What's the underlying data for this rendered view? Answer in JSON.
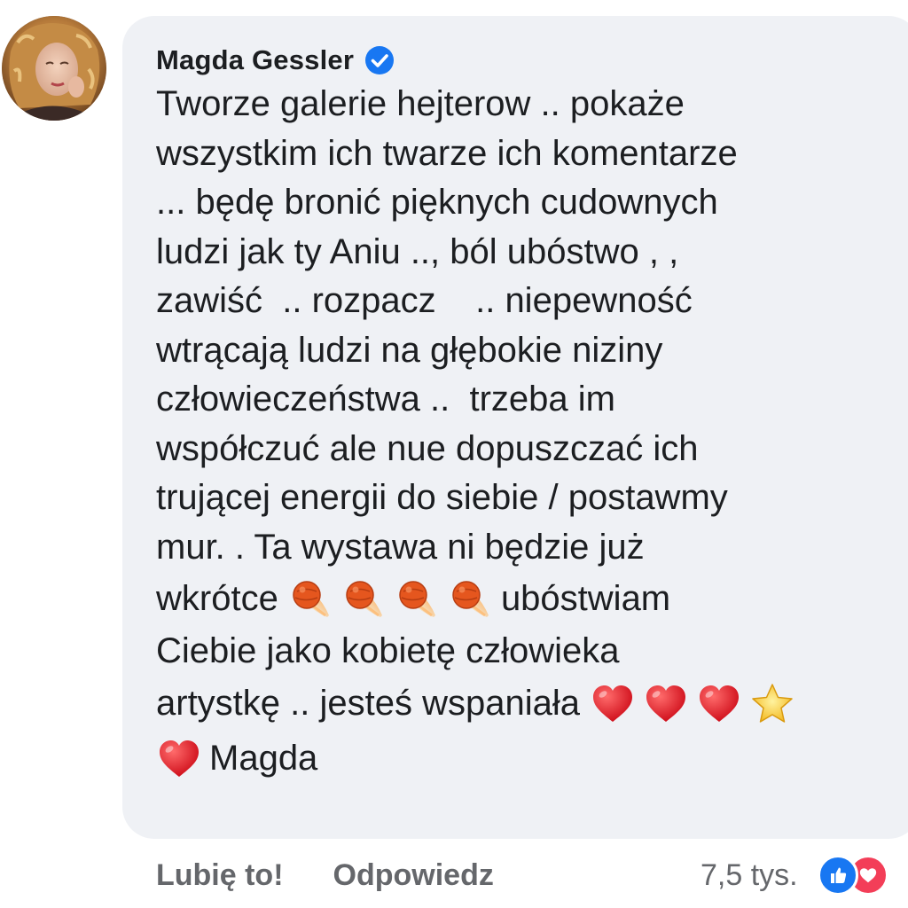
{
  "comment": {
    "author": "Magda Gessler",
    "verified": true,
    "lines": [
      [
        "Tworze galerie hejterow .. pokaże"
      ],
      [
        "wszystkim ich twarze ich komentarze"
      ],
      [
        "... będę bronić pięknych cudownych"
      ],
      [
        "ludzi jak ty Aniu .., ból ubóstwo , ,"
      ],
      [
        "zawiść  .. rozpacz    .. niepewność"
      ],
      [
        "wtrącają ludzi na głębokie niziny"
      ],
      [
        "człowieczeństwa ..  trzeba im"
      ],
      [
        "współczuć ale nue dopuszczać ich"
      ],
      [
        "trującej energii do siebie / postawmy"
      ],
      [
        "mur. . Ta wystawa ni będzie już"
      ],
      [
        "wkrótce ",
        "comet-emoji",
        "comet-emoji",
        "comet-emoji",
        "comet-emoji",
        "ubóstwiam"
      ],
      [
        "Ciebie jako kobietę człowieka"
      ],
      [
        "artystkę .. jesteś wspaniała ",
        "heart-emoji",
        "heart-emoji",
        "heart-emoji",
        "star-emoji"
      ],
      [
        "heart-emoji",
        "Magda"
      ]
    ]
  },
  "actions": {
    "like_label": "Lubię to!",
    "reply_label": "Odpowiedz"
  },
  "reactions": {
    "count": "7,5 tys.",
    "types": [
      "like-icon",
      "love-icon"
    ]
  },
  "colors": {
    "bubble": "#eff1f5",
    "text": "#1c1e21",
    "secondary_text": "#65676b",
    "verified_blue": "#1877f2",
    "love_red": "#f33e58"
  }
}
